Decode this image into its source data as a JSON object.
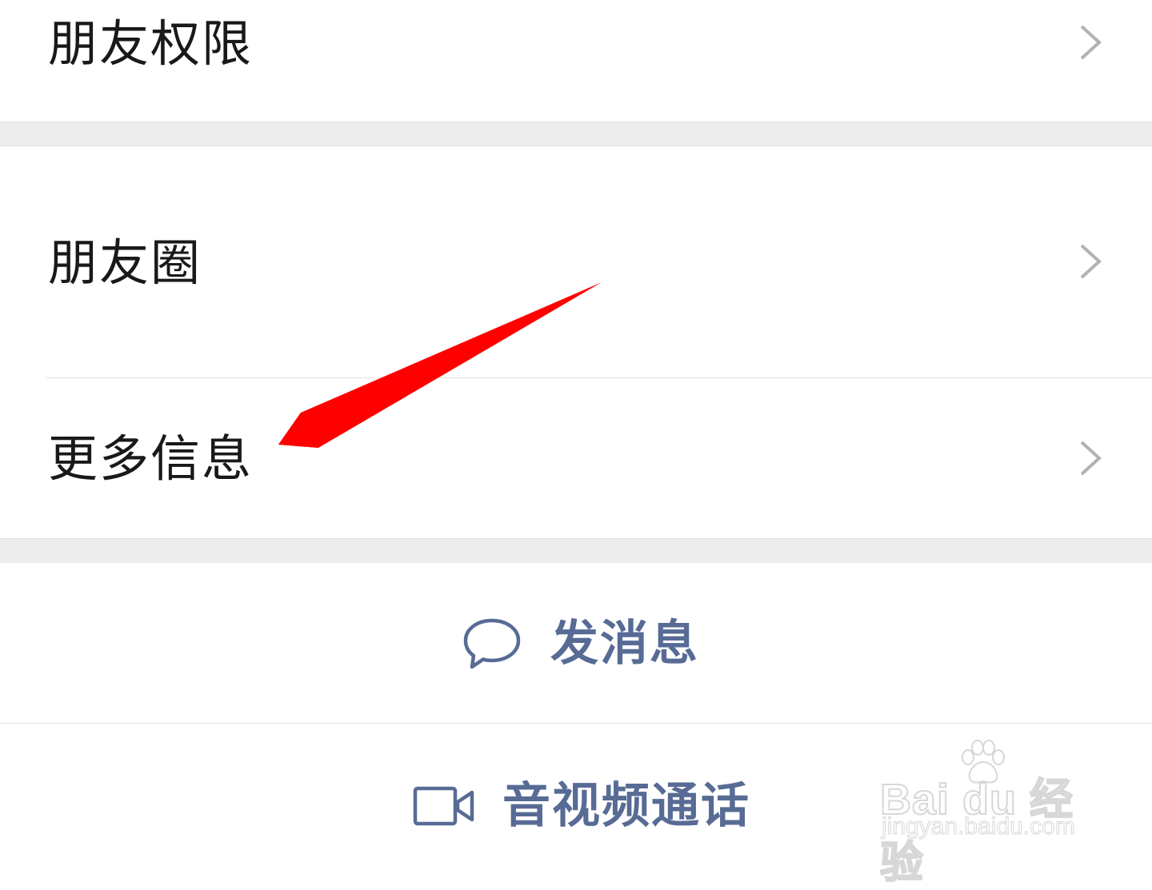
{
  "sections": {
    "permissions": {
      "label": "朋友权限"
    },
    "moments": {
      "label": "朋友圈"
    },
    "more_info": {
      "label": "更多信息"
    }
  },
  "actions": {
    "send_message": {
      "label": "发消息",
      "icon": "chat-bubble-icon"
    },
    "av_call": {
      "label": "音视频通话",
      "icon": "video-camera-icon"
    }
  },
  "watermark": {
    "brand": "Bai du 经验",
    "url": "jingyan.baidu.com"
  },
  "colors": {
    "link_blue": "#576b95",
    "separator_gray": "#ededed",
    "chevron_gray": "#b2b2b2",
    "annotation_red": "#ff0000"
  }
}
